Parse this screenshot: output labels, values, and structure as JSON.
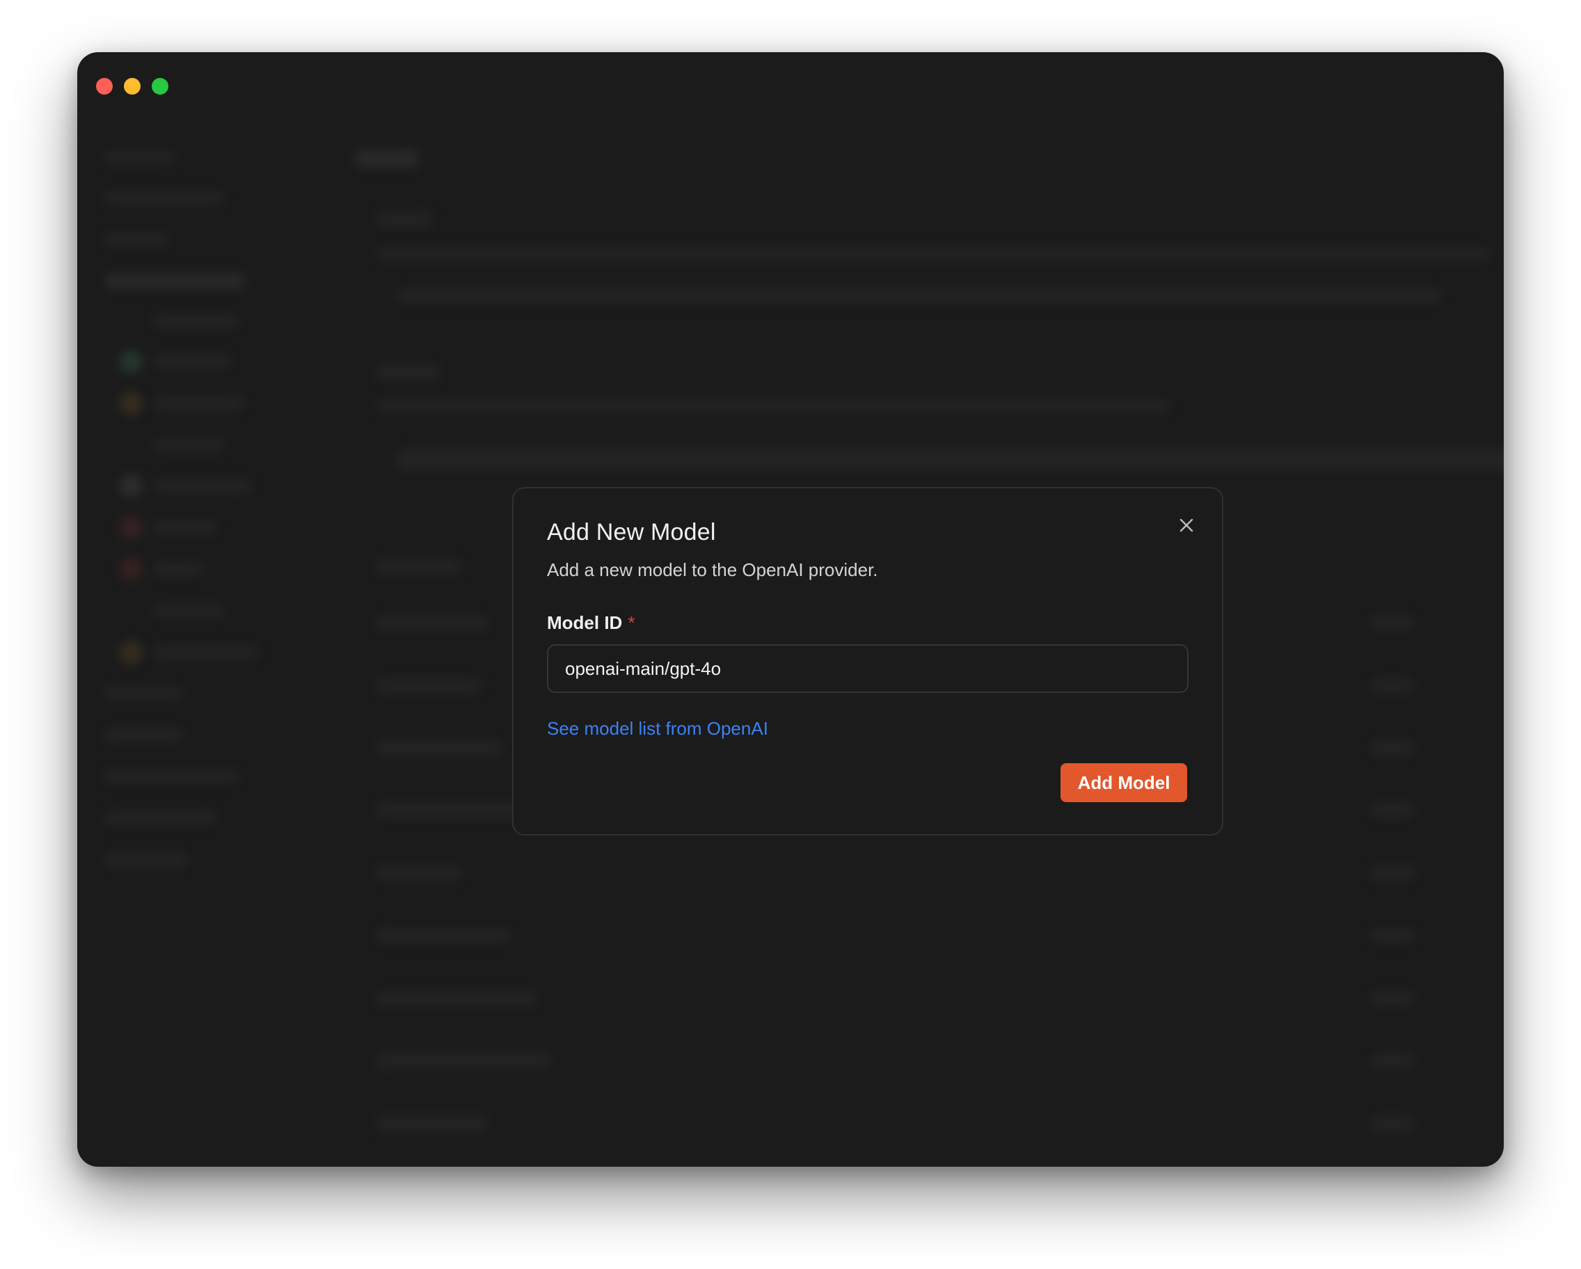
{
  "window": {
    "controls": [
      "close",
      "minimize",
      "maximize"
    ]
  },
  "colors": {
    "window_bg": "#1b1b1b",
    "accent": "#e2572c",
    "link": "#3b82f6",
    "required": "#d9443a"
  },
  "dialog": {
    "title": "Add New Model",
    "subtitle": "Add a new model to the OpenAI provider.",
    "close_icon": "close-icon",
    "field": {
      "label": "Model ID",
      "required_mark": "*",
      "value": "openai-main/gpt-4o"
    },
    "link_text": "See model list from OpenAI",
    "submit_label": "Add Model"
  }
}
